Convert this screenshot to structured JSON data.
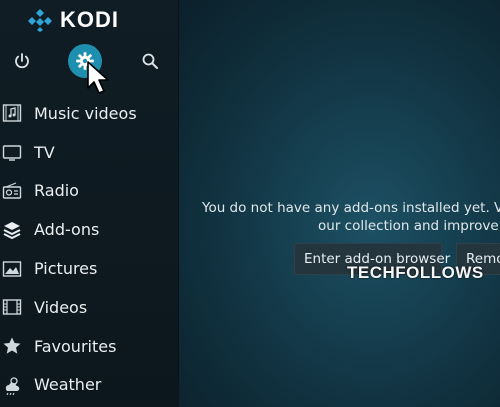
{
  "app": {
    "logo_text": "KODI"
  },
  "top_bar": {
    "icons": [
      "power-icon",
      "settings-icon",
      "search-icon"
    ],
    "active": "settings-icon"
  },
  "menu": {
    "items": [
      {
        "label": "Music videos",
        "icon": "music-videos-icon"
      },
      {
        "label": "TV",
        "icon": "tv-icon"
      },
      {
        "label": "Radio",
        "icon": "radio-icon"
      },
      {
        "label": "Add-ons",
        "icon": "addons-icon"
      },
      {
        "label": "Pictures",
        "icon": "pictures-icon"
      },
      {
        "label": "Videos",
        "icon": "videos-icon"
      },
      {
        "label": "Favourites",
        "icon": "star-icon"
      },
      {
        "label": "Weather",
        "icon": "weather-icon"
      }
    ]
  },
  "main": {
    "message_line1": "You do not have any add-ons installed yet. Visit o",
    "message_line2": "our collection and improve yo",
    "buttons": {
      "browser": "Enter add-on browser",
      "remove": "Remo"
    }
  },
  "watermark": {
    "text": "TECHFOLLOWS"
  },
  "colors": {
    "accent": "#1f8fb0",
    "sidebar_bg": "#101d24",
    "main_bg": "#153e4e",
    "button_bg": "#24353e"
  }
}
